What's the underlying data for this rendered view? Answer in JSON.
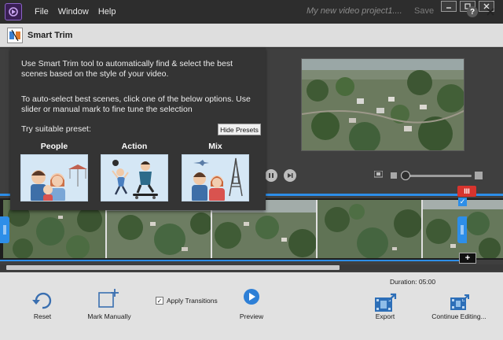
{
  "menubar": {
    "menus": [
      "File",
      "Window",
      "Help"
    ],
    "project_title": "My new video project1....",
    "save_label": "Save",
    "minimize": "—",
    "maximize": "☐",
    "close": "✕"
  },
  "dialog": {
    "title": "Smart Trim",
    "help_symbol": "?",
    "close_symbol": "✕"
  },
  "presets_panel": {
    "intro": "Use Smart Trim tool to automatically find & select the best scenes based on the style of your video.",
    "instructions": "To auto-select best scenes, click one of the below options. Use slider or manual mark to fine tune the selection",
    "try_label": "Try suitable preset:",
    "hide_button": "Hide Presets",
    "presets": [
      {
        "label": "People",
        "icon": "family-icon"
      },
      {
        "label": "Action",
        "icon": "action-icon"
      },
      {
        "label": "Mix",
        "icon": "mix-icon"
      }
    ]
  },
  "timeline": {
    "marker_symbol": "III",
    "check_symbol": "✓",
    "add_symbol": "+"
  },
  "bottom_bar": {
    "duration": "Duration: 05:00",
    "reset_label": "Reset",
    "mark_manually_label": "Mark Manually",
    "apply_transitions_label": "Apply Transitions",
    "apply_transitions_checked": true,
    "preview_label": "Preview",
    "export_label": "Export",
    "continue_label": "Continue Editing..."
  },
  "colors": {
    "accent_blue": "#2d8ee8",
    "marker_red": "#d7342e",
    "panel_dark": "#3f3f3f",
    "toolbar_light": "#e1e1e1"
  }
}
